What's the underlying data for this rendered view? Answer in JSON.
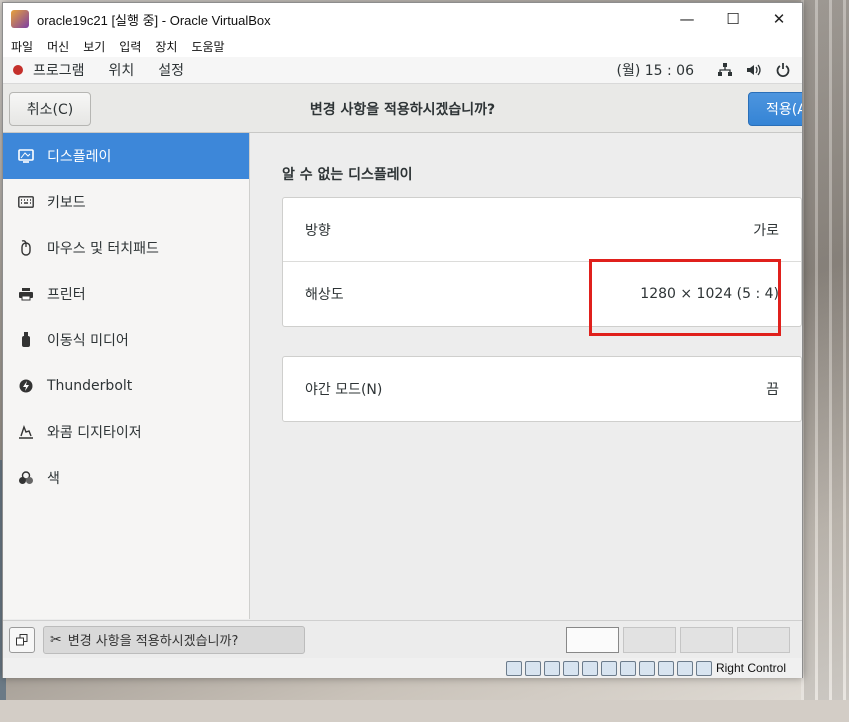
{
  "window": {
    "title": "oracle19c21 [실행 중] - Oracle VirtualBox",
    "minimize": "—",
    "maximize": "☐",
    "close": "✕"
  },
  "menubar": [
    "파일",
    "머신",
    "보기",
    "입력",
    "장치",
    "도움말"
  ],
  "guest_topbar": {
    "items": [
      "프로그램",
      "위치",
      "설정"
    ],
    "clock": "(월) 15 : 06",
    "icons": [
      "network-icon",
      "volume-icon",
      "power-icon"
    ]
  },
  "headerbar": {
    "cancel": "취소(C)",
    "title": "변경 사항을 적용하시겠습니까?",
    "apply": "적용(A)"
  },
  "sidebar": {
    "items": [
      {
        "label": "디스플레이",
        "icon": "display-icon",
        "active": true
      },
      {
        "label": "키보드",
        "icon": "keyboard-icon",
        "active": false
      },
      {
        "label": "마우스 및 터치패드",
        "icon": "mouse-icon",
        "active": false
      },
      {
        "label": "프린터",
        "icon": "printer-icon",
        "active": false
      },
      {
        "label": "이동식 미디어",
        "icon": "removable-media-icon",
        "active": false
      },
      {
        "label": "Thunderbolt",
        "icon": "thunderbolt-icon",
        "active": false
      },
      {
        "label": "와콤 디지타이저",
        "icon": "wacom-tablet-icon",
        "active": false
      },
      {
        "label": "색",
        "icon": "color-icon",
        "active": false
      }
    ]
  },
  "display": {
    "section_title": "알 수 없는 디스플레이",
    "orientation_label": "방향",
    "orientation_value": "가로",
    "resolution_label": "해상도",
    "resolution_value": "1280 × 1024 (5 : 4)",
    "night_mode_label": "야간 모드(N)",
    "night_mode_value": "끔"
  },
  "vbox_bottom": {
    "notification": "변경 사항을 적용하시겠습니까?",
    "workspaces": 4,
    "active_workspace": 1
  },
  "statusbar": {
    "host_key": "Right Control"
  },
  "colors": {
    "accent": "#3d87d9",
    "highlight": "#e0201c"
  }
}
